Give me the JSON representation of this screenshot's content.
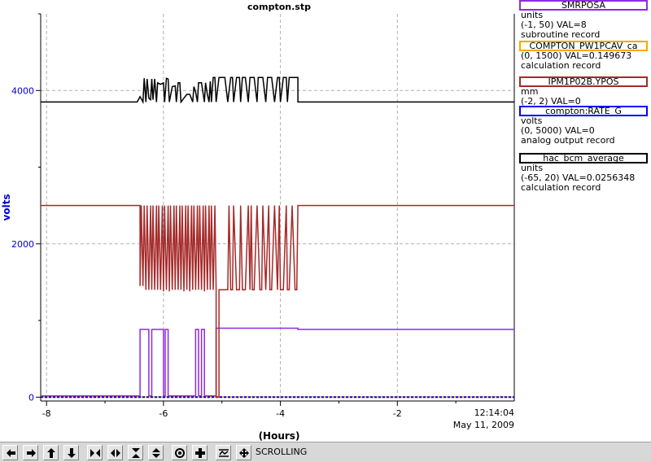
{
  "chart_data": {
    "type": "line",
    "title": "compton.stp",
    "xlabel": "(Hours)",
    "ylabel": "volts",
    "xlim": [
      -8.1,
      0
    ],
    "ylim": [
      -50,
      5000
    ],
    "x_ticks": [
      -8,
      -6,
      -4,
      -2
    ],
    "y_ticks": [
      0,
      2000,
      4000
    ],
    "timestamp": "12:14:04",
    "date": "May 11, 2009",
    "grid": true,
    "legend_position": "right",
    "series": [
      {
        "name": "SMRPOSA",
        "color": "#8b2be2",
        "unit": "units",
        "range_val": "(-1, 50) VAL=8",
        "record": "subroutine record",
        "x": [
          -8.1,
          -6.4,
          -6.4,
          -6.25,
          -6.25,
          -6.2,
          -6.2,
          -6.0,
          -6.0,
          -5.97,
          -5.97,
          -5.92,
          -5.92,
          -5.45,
          -5.45,
          -5.4,
          -5.4,
          -5.35,
          -5.35,
          -5.3,
          -5.3,
          -5.1,
          -5.1,
          -3.7,
          -3.7,
          0
        ],
        "values": [
          16,
          16,
          884,
          884,
          16,
          16,
          884,
          884,
          16,
          16,
          884,
          884,
          16,
          16,
          884,
          884,
          16,
          16,
          884,
          884,
          16,
          16,
          900,
          900,
          884,
          884
        ]
      },
      {
        "name": "COMPTON_PW1PCAV_ca",
        "color": "#ffa500",
        "unit": "",
        "range_val": "(0, 1500) VAL=0.149673",
        "record": "calculation record",
        "x": [
          -8.1,
          0
        ],
        "values": [
          3,
          3
        ]
      },
      {
        "name": "IPM1P02B.YPOS",
        "color": "#a52a2a",
        "unit": "mm",
        "range_val": "(-2, 2) VAL=0",
        "record": "",
        "x": [
          -8.1,
          -6.4,
          -6.4,
          -6.38,
          -6.35,
          -6.33,
          -6.3,
          -6.28,
          -6.25,
          -6.22,
          -6.2,
          -6.18,
          -6.15,
          -6.12,
          -6.1,
          -6.08,
          -6.05,
          -6.02,
          -6.0,
          -5.98,
          -5.95,
          -5.92,
          -5.9,
          -5.88,
          -5.85,
          -5.82,
          -5.8,
          -5.78,
          -5.75,
          -5.72,
          -5.7,
          -5.68,
          -5.65,
          -5.62,
          -5.6,
          -5.58,
          -5.55,
          -5.52,
          -5.5,
          -5.48,
          -5.45,
          -5.42,
          -5.4,
          -5.38,
          -5.35,
          -5.32,
          -5.3,
          -5.28,
          -5.25,
          -5.22,
          -5.2,
          -5.18,
          -5.15,
          -5.12,
          -5.1,
          -5.1,
          -5.05,
          -5.05,
          -4.9,
          -4.88,
          -4.85,
          -4.82,
          -4.8,
          -4.75,
          -4.7,
          -4.68,
          -4.65,
          -4.6,
          -4.55,
          -4.52,
          -4.5,
          -4.48,
          -4.45,
          -4.4,
          -4.35,
          -4.32,
          -4.3,
          -4.25,
          -4.2,
          -4.18,
          -4.15,
          -4.1,
          -4.05,
          -4.02,
          -4.0,
          -3.95,
          -3.9,
          -3.88,
          -3.85,
          -3.8,
          -3.75,
          -3.72,
          -3.7,
          -3.7,
          0
        ],
        "values": [
          2500,
          2500,
          1450,
          2500,
          1450,
          2500,
          1400,
          2500,
          1400,
          2500,
          1400,
          2500,
          1400,
          2500,
          1400,
          2500,
          1400,
          2500,
          1380,
          2500,
          1400,
          2500,
          1380,
          2500,
          1400,
          2500,
          1400,
          2500,
          1400,
          2500,
          1400,
          2500,
          1380,
          2500,
          1400,
          2500,
          1380,
          2500,
          1400,
          2500,
          1400,
          2500,
          1400,
          2500,
          1400,
          2500,
          1380,
          2500,
          1400,
          2500,
          1400,
          2500,
          1400,
          2500,
          1400,
          0,
          0,
          1400,
          1400,
          2500,
          1400,
          1400,
          2500,
          1400,
          1400,
          2500,
          1400,
          1400,
          2500,
          1400,
          2500,
          1400,
          1400,
          2500,
          1400,
          1400,
          2500,
          1400,
          2500,
          1400,
          1400,
          2500,
          1400,
          2500,
          1400,
          1400,
          2500,
          1400,
          1400,
          2500,
          1400,
          1400,
          2500,
          2500,
          2500
        ]
      },
      {
        "name": "compton:RATE_G",
        "color": "#0000ff",
        "unit": "volts",
        "range_val": "(0, 5000) VAL=0",
        "record": "analog output record",
        "x": [
          -8.1,
          0
        ],
        "values": [
          0,
          0
        ]
      },
      {
        "name": "hac_bcm_average",
        "color": "#000000",
        "unit": "units",
        "range_val": "(-65, 20) VAL=0.0256348",
        "record": "calculation record",
        "x": [
          -8.1,
          -6.5,
          -6.45,
          -6.4,
          -6.35,
          -6.33,
          -6.3,
          -6.28,
          -6.25,
          -6.22,
          -6.2,
          -6.18,
          -6.15,
          -6.12,
          -6.1,
          -6.05,
          -6.0,
          -5.98,
          -5.95,
          -5.92,
          -5.9,
          -5.85,
          -5.8,
          -5.78,
          -5.75,
          -5.72,
          -5.7,
          -5.65,
          -5.6,
          -5.55,
          -5.5,
          -5.48,
          -5.45,
          -5.42,
          -5.4,
          -5.35,
          -5.3,
          -5.28,
          -5.25,
          -5.22,
          -5.2,
          -5.18,
          -5.15,
          -5.12,
          -5.1,
          -5.05,
          -5.0,
          -4.95,
          -4.9,
          -4.85,
          -4.82,
          -4.8,
          -4.75,
          -4.7,
          -4.68,
          -4.65,
          -4.6,
          -4.55,
          -4.52,
          -4.5,
          -4.45,
          -4.4,
          -4.38,
          -4.35,
          -4.3,
          -4.25,
          -4.22,
          -4.2,
          -4.15,
          -4.1,
          -4.05,
          -4.02,
          -4.0,
          -3.95,
          -3.9,
          -3.88,
          -3.85,
          -3.8,
          -3.75,
          -3.7,
          -3.7,
          0
        ],
        "values": [
          3850,
          3850,
          3850,
          3920,
          3850,
          4160,
          3850,
          4150,
          3900,
          3880,
          4150,
          3880,
          4150,
          3850,
          4100,
          4080,
          4100,
          3850,
          4160,
          4150,
          3850,
          4050,
          4060,
          3850,
          4100,
          4100,
          3850,
          3900,
          3950,
          3950,
          3850,
          4050,
          3980,
          3850,
          4100,
          4100,
          3850,
          4100,
          3950,
          3850,
          4120,
          3850,
          4170,
          4170,
          3850,
          4170,
          4170,
          4170,
          3850,
          4170,
          4170,
          3850,
          4170,
          4170,
          3850,
          4170,
          4170,
          3850,
          4170,
          4170,
          4170,
          3850,
          4170,
          4170,
          4170,
          3850,
          4170,
          4170,
          4170,
          3850,
          4170,
          4170,
          3850,
          4170,
          4170,
          3850,
          4170,
          4170,
          4170,
          4170,
          3850,
          3850
        ]
      }
    ]
  },
  "toolbar": {
    "buttons": [
      "arrow-left-icon",
      "arrow-right-icon",
      "arrow-up-icon",
      "arrow-down-icon",
      "expand-horizontal-icon",
      "compress-horizontal-icon",
      "expand-vertical-icon",
      "compress-vertical-icon",
      "target-icon",
      "plus-icon",
      "fit-icon",
      "pan-icon"
    ],
    "mode_label": "SCROLLING"
  }
}
